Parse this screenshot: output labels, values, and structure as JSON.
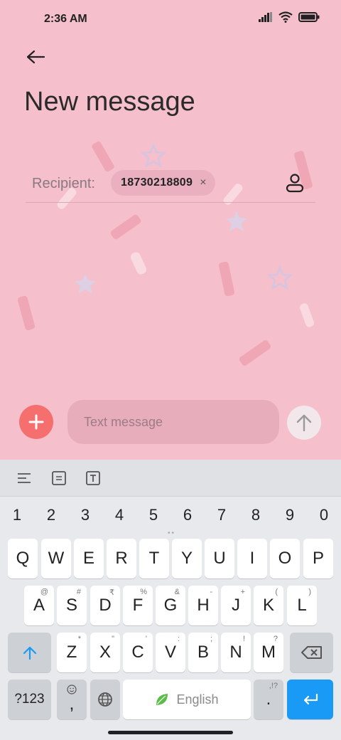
{
  "status_bar": {
    "time": "2:36 AM"
  },
  "header": {
    "title": "New message"
  },
  "recipient": {
    "label": "Recipient:",
    "chip_number": "18730218809",
    "chip_remove": "×"
  },
  "compose": {
    "placeholder": "Text message"
  },
  "keyboard": {
    "numbers": [
      "1",
      "2",
      "3",
      "4",
      "5",
      "6",
      "7",
      "8",
      "9",
      "0"
    ],
    "row1": [
      "Q",
      "W",
      "E",
      "R",
      "T",
      "Y",
      "U",
      "I",
      "O",
      "P"
    ],
    "row2": [
      "A",
      "S",
      "D",
      "F",
      "G",
      "H",
      "J",
      "K",
      "L"
    ],
    "row2_sup": [
      "@",
      "#",
      "₹",
      "%",
      "&",
      "-",
      "+",
      "(",
      ")"
    ],
    "row3": [
      "Z",
      "X",
      "C",
      "V",
      "B",
      "N",
      "M"
    ],
    "row3_sup": [
      "*",
      "\"",
      "'",
      ":",
      ";",
      "!",
      "?"
    ],
    "symbols_label": "?123",
    "comma_label": ",",
    "space_label": "English",
    "period_label": ".",
    "period_sup": ",!?"
  },
  "colors": {
    "background": "#f5bfcc",
    "accent_red": "#f56f6f",
    "enter_blue": "#1a9af7"
  }
}
